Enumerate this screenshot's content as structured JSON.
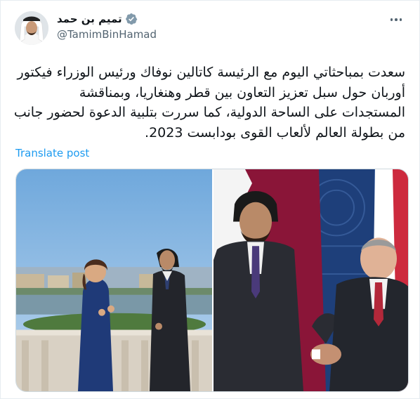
{
  "author": {
    "display_name": "تميم بن حمد",
    "handle": "@TamimBinHamad",
    "verified_icon": "verified-badge-icon"
  },
  "tweet": {
    "lines": [
      "سعدت بمباحثاتي اليوم مع الرئيسة كاتالين نوفاك ورئيس الوزراء فيكتور",
      "أوربان حول سبل تعزيز التعاون بين قطر وهنغاريا، وبمناقشة",
      "المستجدات على الساحة الدولية، كما سررت بتلبية الدعوة لحضور جانب",
      "من بطولة العالم لألعاب القوى بودابست 2023."
    ],
    "translate_label": "Translate post"
  },
  "colors": {
    "link": "#1d9bf0",
    "secondary_text": "#536471",
    "verified_badge": "#829aab",
    "qatar_maroon": "#8a1538"
  }
}
